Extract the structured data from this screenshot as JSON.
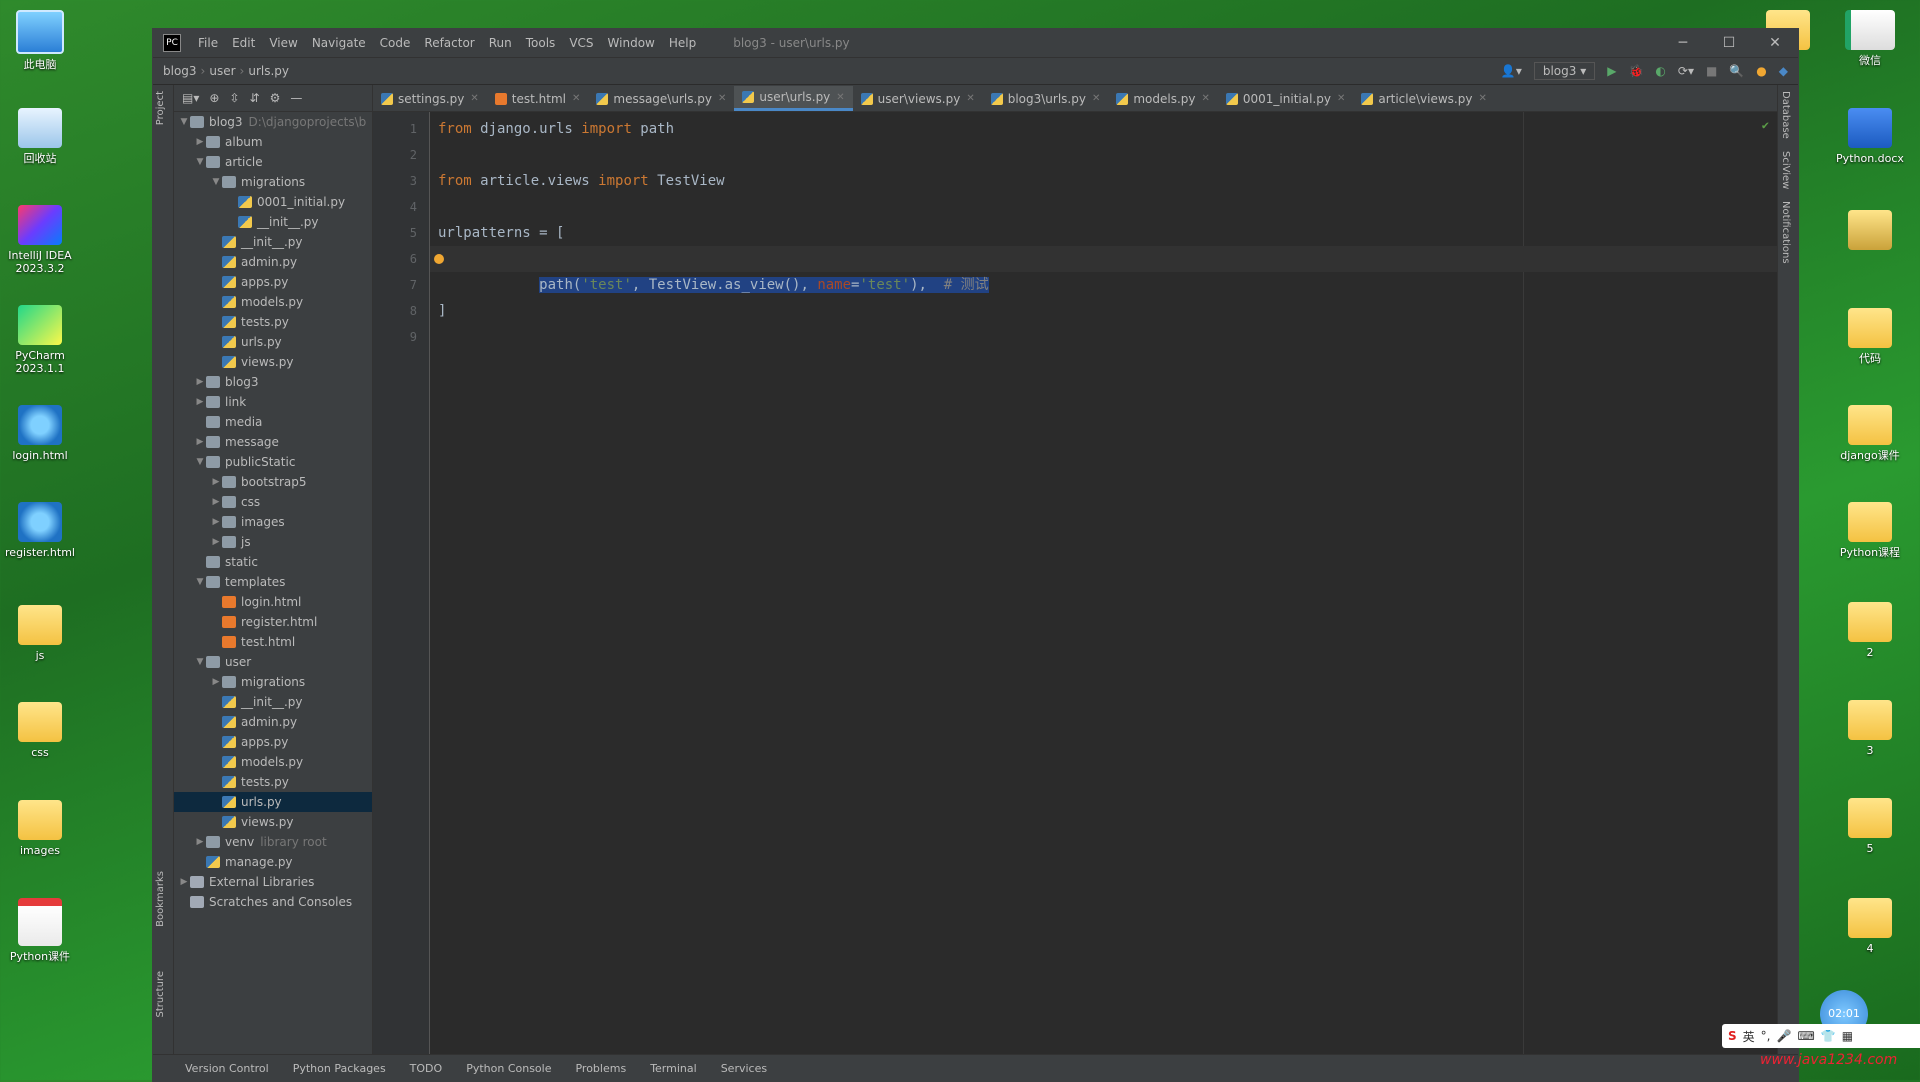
{
  "desktop": {
    "left_icons": [
      {
        "label": "此电脑",
        "icon": "computer-icon"
      },
      {
        "label": "回收站",
        "icon": "recycle-bin-icon"
      },
      {
        "label": "IntelliJ IDEA 2023.3.2",
        "icon": "intellij-icon"
      },
      {
        "label": "PyCharm 2023.1.1",
        "icon": "pycharm-icon"
      },
      {
        "label": "login.html",
        "icon": "ie-icon"
      },
      {
        "label": "register.html",
        "icon": "ie-icon"
      },
      {
        "label": "js",
        "icon": "folder-icon"
      },
      {
        "label": "css",
        "icon": "folder-icon"
      },
      {
        "label": "images",
        "icon": "folder-icon"
      },
      {
        "label": "Python课件",
        "icon": "pdf-icon"
      }
    ],
    "right_icons": [
      {
        "label": "",
        "icon": "folder-icon"
      },
      {
        "label": "微信",
        "icon": "spreadsheet-icon"
      },
      {
        "label": "Python.docx",
        "icon": "word-doc-icon"
      },
      {
        "label": "",
        "icon": "card-icon"
      },
      {
        "label": "代码",
        "icon": "folder-icon"
      },
      {
        "label": "django课件",
        "icon": "folder-icon"
      },
      {
        "label": "Python课程",
        "icon": "folder-icon"
      },
      {
        "label": "2",
        "icon": "folder-icon"
      },
      {
        "label": "3",
        "icon": "folder-icon"
      },
      {
        "label": "5",
        "icon": "folder-icon"
      },
      {
        "label": "4",
        "icon": "folder-icon"
      }
    ],
    "clock": "02:01",
    "watermark": "www.java1234.com",
    "ime": {
      "brand": "S",
      "mode": "英"
    }
  },
  "ide": {
    "title": "blog3 - user\\urls.py",
    "menu": [
      "File",
      "Edit",
      "View",
      "Navigate",
      "Code",
      "Refactor",
      "Run",
      "Tools",
      "VCS",
      "Window",
      "Help"
    ],
    "breadcrumb": [
      "blog3",
      "user",
      "urls.py"
    ],
    "run_config": "blog3",
    "left_strip": [
      "Project",
      "Bookmarks",
      "Structure"
    ],
    "right_strip": [
      "Database",
      "SciView",
      "Notifications"
    ],
    "project_tree": [
      {
        "depth": 0,
        "arrow": "v",
        "icon": "folder",
        "label": "blog3",
        "hint": "D:\\djangoprojects\\b"
      },
      {
        "depth": 1,
        "arrow": ">",
        "icon": "folder",
        "label": "album",
        "hint": ""
      },
      {
        "depth": 1,
        "arrow": "v",
        "icon": "folder",
        "label": "article",
        "hint": ""
      },
      {
        "depth": 2,
        "arrow": "v",
        "icon": "folder",
        "label": "migrations",
        "hint": ""
      },
      {
        "depth": 3,
        "arrow": "",
        "icon": "py",
        "label": "0001_initial.py",
        "hint": ""
      },
      {
        "depth": 3,
        "arrow": "",
        "icon": "py",
        "label": "__init__.py",
        "hint": ""
      },
      {
        "depth": 2,
        "arrow": "",
        "icon": "py",
        "label": "__init__.py",
        "hint": ""
      },
      {
        "depth": 2,
        "arrow": "",
        "icon": "py",
        "label": "admin.py",
        "hint": ""
      },
      {
        "depth": 2,
        "arrow": "",
        "icon": "py",
        "label": "apps.py",
        "hint": ""
      },
      {
        "depth": 2,
        "arrow": "",
        "icon": "py",
        "label": "models.py",
        "hint": ""
      },
      {
        "depth": 2,
        "arrow": "",
        "icon": "py",
        "label": "tests.py",
        "hint": ""
      },
      {
        "depth": 2,
        "arrow": "",
        "icon": "py",
        "label": "urls.py",
        "hint": ""
      },
      {
        "depth": 2,
        "arrow": "",
        "icon": "py",
        "label": "views.py",
        "hint": ""
      },
      {
        "depth": 1,
        "arrow": ">",
        "icon": "folder",
        "label": "blog3",
        "hint": ""
      },
      {
        "depth": 1,
        "arrow": ">",
        "icon": "folder",
        "label": "link",
        "hint": ""
      },
      {
        "depth": 1,
        "arrow": "",
        "icon": "folder",
        "label": "media",
        "hint": ""
      },
      {
        "depth": 1,
        "arrow": ">",
        "icon": "folder",
        "label": "message",
        "hint": ""
      },
      {
        "depth": 1,
        "arrow": "v",
        "icon": "folder",
        "label": "publicStatic",
        "hint": ""
      },
      {
        "depth": 2,
        "arrow": ">",
        "icon": "folder",
        "label": "bootstrap5",
        "hint": ""
      },
      {
        "depth": 2,
        "arrow": ">",
        "icon": "folder",
        "label": "css",
        "hint": ""
      },
      {
        "depth": 2,
        "arrow": ">",
        "icon": "folder",
        "label": "images",
        "hint": ""
      },
      {
        "depth": 2,
        "arrow": ">",
        "icon": "folder",
        "label": "js",
        "hint": ""
      },
      {
        "depth": 1,
        "arrow": "",
        "icon": "folder",
        "label": "static",
        "hint": ""
      },
      {
        "depth": 1,
        "arrow": "v",
        "icon": "folder",
        "label": "templates",
        "hint": ""
      },
      {
        "depth": 2,
        "arrow": "",
        "icon": "html",
        "label": "login.html",
        "hint": ""
      },
      {
        "depth": 2,
        "arrow": "",
        "icon": "html",
        "label": "register.html",
        "hint": ""
      },
      {
        "depth": 2,
        "arrow": "",
        "icon": "html",
        "label": "test.html",
        "hint": ""
      },
      {
        "depth": 1,
        "arrow": "v",
        "icon": "folder",
        "label": "user",
        "hint": ""
      },
      {
        "depth": 2,
        "arrow": ">",
        "icon": "folder",
        "label": "migrations",
        "hint": ""
      },
      {
        "depth": 2,
        "arrow": "",
        "icon": "py",
        "label": "__init__.py",
        "hint": ""
      },
      {
        "depth": 2,
        "arrow": "",
        "icon": "py",
        "label": "admin.py",
        "hint": ""
      },
      {
        "depth": 2,
        "arrow": "",
        "icon": "py",
        "label": "apps.py",
        "hint": ""
      },
      {
        "depth": 2,
        "arrow": "",
        "icon": "py",
        "label": "models.py",
        "hint": ""
      },
      {
        "depth": 2,
        "arrow": "",
        "icon": "py",
        "label": "tests.py",
        "hint": ""
      },
      {
        "depth": 2,
        "arrow": "",
        "icon": "py",
        "label": "urls.py",
        "hint": "",
        "selected": true
      },
      {
        "depth": 2,
        "arrow": "",
        "icon": "py",
        "label": "views.py",
        "hint": ""
      },
      {
        "depth": 1,
        "arrow": ">",
        "icon": "folder",
        "label": "venv",
        "hint": "library root"
      },
      {
        "depth": 1,
        "arrow": "",
        "icon": "py",
        "label": "manage.py",
        "hint": ""
      },
      {
        "depth": 0,
        "arrow": ">",
        "icon": "lib",
        "label": "External Libraries",
        "hint": ""
      },
      {
        "depth": 0,
        "arrow": "",
        "icon": "lib",
        "label": "Scratches and Consoles",
        "hint": ""
      }
    ],
    "tabs": [
      {
        "label": "settings.py",
        "type": "py",
        "active": false
      },
      {
        "label": "test.html",
        "type": "html",
        "active": false
      },
      {
        "label": "message\\urls.py",
        "type": "py",
        "active": false
      },
      {
        "label": "user\\urls.py",
        "type": "py",
        "active": true
      },
      {
        "label": "user\\views.py",
        "type": "py",
        "active": false
      },
      {
        "label": "blog3\\urls.py",
        "type": "py",
        "active": false
      },
      {
        "label": "models.py",
        "type": "py",
        "active": false
      },
      {
        "label": "0001_initial.py",
        "type": "py",
        "active": false
      },
      {
        "label": "article\\views.py",
        "type": "py",
        "active": false
      }
    ],
    "line_numbers": [
      "1",
      "2",
      "3",
      "4",
      "5",
      "6",
      "7",
      "8",
      "9"
    ],
    "code": {
      "l1_kw1": "from",
      "l1_mod": " django.urls ",
      "l1_kw2": "import",
      "l1_name": " path",
      "l3_kw1": "from",
      "l3_mod": " article.views ",
      "l3_kw2": "import",
      "l3_name": " TestView",
      "l5": "urlpatterns = [",
      "l6_indent": "    ",
      "l6_call": "path(",
      "l6_str1": "'test'",
      "l6_mid": ", TestView.as_view(), ",
      "l6_param": "name",
      "l6_eq": "=",
      "l6_str2": "'test'",
      "l6_end": "),  ",
      "l6_cmt": "# 测试",
      "l8": "]"
    },
    "bottom_tools": [
      "Version Control",
      "Python Packages",
      "TODO",
      "Python Console",
      "Problems",
      "Terminal",
      "Services"
    ]
  }
}
